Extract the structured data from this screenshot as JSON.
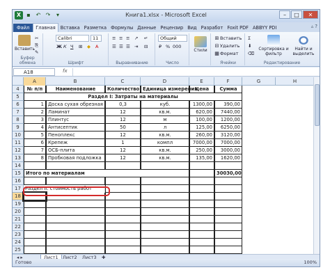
{
  "window": {
    "title": "Книга1.xlsx - Microsoft Excel"
  },
  "tabs": [
    {
      "label": "Файл",
      "active": false
    },
    {
      "label": "Главная",
      "active": true
    },
    {
      "label": "Вставка",
      "active": false
    },
    {
      "label": "Разметка",
      "active": false
    },
    {
      "label": "Формулы",
      "active": false
    },
    {
      "label": "Данные",
      "active": false
    },
    {
      "label": "Рецензир",
      "active": false
    },
    {
      "label": "Вид",
      "active": false
    },
    {
      "label": "Разработ",
      "active": false
    },
    {
      "label": "Foxit PDF",
      "active": false
    },
    {
      "label": "ABBYY PDI",
      "active": false
    }
  ],
  "ribbon": {
    "paste_label": "Вставить",
    "clipboard_label": "Буфер обмена",
    "font_name": "Calibri",
    "font_size": "11",
    "font_label": "Шрифт",
    "alignment_label": "Выравнивание",
    "number_format": "Общий",
    "number_label": "Число",
    "styles_button": "Стили",
    "insert_label": "Вставить",
    "delete_label": "Удалить",
    "format_label": "Формат",
    "cells_label": "Ячейки",
    "sort_label": "Сортировка и фильтр",
    "find_label": "Найти и выделить",
    "editing_label": "Редактирование",
    "bold": "Ж",
    "italic": "К",
    "underline": "Ч"
  },
  "formula_bar": {
    "name_box": "A18",
    "fx": "fx",
    "value": ""
  },
  "columns": [
    "A",
    "B",
    "C",
    "D",
    "E",
    "F",
    "G",
    "H"
  ],
  "row_numbers": [
    "4",
    "5",
    "6",
    "7",
    "8",
    "9",
    "10",
    "11",
    "12",
    "13",
    "14",
    "15",
    "16",
    "17",
    "18",
    "19",
    "20",
    "21",
    "22",
    "23",
    "24",
    "25",
    "26",
    "27",
    "28",
    "29",
    "30",
    "31",
    "32",
    "33"
  ],
  "rows": [
    {
      "n": "4",
      "A": "№ п/п",
      "B": "Наименование",
      "C": "Количество",
      "D": "Единица измерения",
      "E": "Цена",
      "F": "Сумма"
    },
    {
      "n": "5",
      "section": "Раздел I: Затраты на материалы"
    },
    {
      "n": "6",
      "A": "1",
      "B": "Доска сухая обрезная",
      "C": "0,3",
      "D": "куб.",
      "E": "1300,00",
      "F": "390,00"
    },
    {
      "n": "7",
      "A": "2",
      "B": "Ламинат",
      "C": "12",
      "D": "кв.м.",
      "E": "620,00",
      "F": "7440,00"
    },
    {
      "n": "8",
      "A": "3",
      "B": "Плинтус",
      "C": "12",
      "D": "м",
      "E": "100,00",
      "F": "1200,00"
    },
    {
      "n": "9",
      "A": "4",
      "B": "Антисептик",
      "C": "50",
      "D": "л",
      "E": "125,00",
      "F": "6250,00"
    },
    {
      "n": "10",
      "A": "5",
      "B": "Пеноплекс",
      "C": "12",
      "D": "кв.м.",
      "E": "260,00",
      "F": "3120,00"
    },
    {
      "n": "11",
      "A": "6",
      "B": "Крепеж",
      "C": "1",
      "D": "компл",
      "E": "7000,00",
      "F": "7000,00"
    },
    {
      "n": "12",
      "A": "7",
      "B": "ОСБ-плита",
      "C": "12",
      "D": "кв.м.",
      "E": "250,00",
      "F": "3000,00"
    },
    {
      "n": "13",
      "A": "8",
      "B": "Пробковая подложка",
      "C": "12",
      "D": "кв.м.",
      "E": "135,00",
      "F": "1620,00"
    },
    {
      "n": "14"
    },
    {
      "n": "15",
      "total_label": "Итого по материалам",
      "total_value": "30030,00"
    },
    {
      "n": "16"
    },
    {
      "n": "17",
      "section2": "Раздел II: стоимость работ"
    },
    {
      "n": "18"
    }
  ],
  "sheets": [
    "Лист1",
    "Лист2",
    "Лист3"
  ],
  "active_sheet": "Лист1",
  "status": {
    "ready": "Готово",
    "zoom": "100%"
  }
}
